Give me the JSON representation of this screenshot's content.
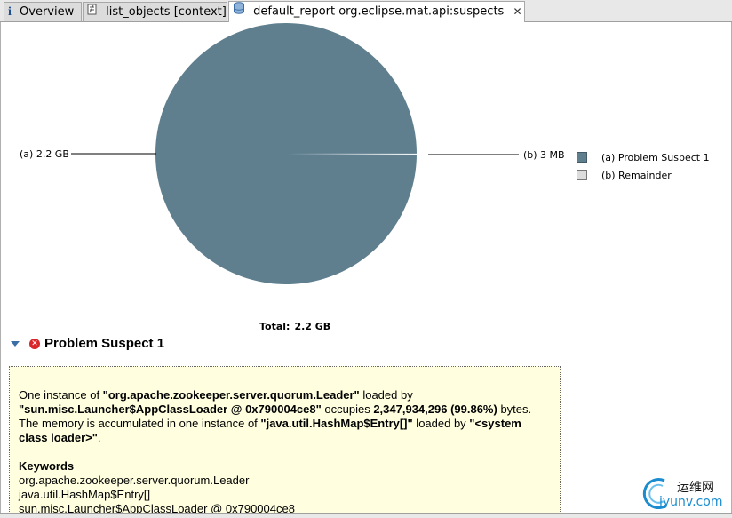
{
  "tabs": [
    {
      "label": "Overview",
      "icon": "info-icon"
    },
    {
      "label": "list_objects [context]",
      "icon": "document-icon"
    },
    {
      "label": "default_report  org.eclipse.mat.api:suspects",
      "icon": "database-icon",
      "active": true
    }
  ],
  "chart_data": {
    "type": "pie",
    "slices": [
      {
        "id": "a",
        "label": "(a)  2.2 GB",
        "value_mb": 2239.2,
        "name": "Problem Suspect 1",
        "color": "#5f7f8f"
      },
      {
        "id": "b",
        "label": "(b)  3 MB",
        "value_mb": 3,
        "name": "Remainder",
        "color": "#dcdcdc"
      }
    ],
    "legend": [
      "(a)  Problem Suspect 1",
      "(b)  Remainder"
    ],
    "legend_position": "right",
    "total_label": "Total:",
    "total_value": "2.2 GB"
  },
  "section": {
    "title": "Problem Suspect 1",
    "twisty_icon": "expand-down-triangle-icon",
    "status_icon": "error-icon"
  },
  "description": {
    "l1_a": "One instance of ",
    "l1_b": "\"org.apache.zookeeper.server.quorum.Leader\"",
    "l1_c": " loaded by",
    "l2_a": "\"sun.misc.Launcher$AppClassLoader @ 0x790004ce8\"",
    "l2_b": " occupies ",
    "l2_c": "2,347,934,296 (99.86%)",
    "l2_d": " bytes.",
    "l3_a": "The memory is accumulated in one instance of ",
    "l3_b": "\"java.util.HashMap$Entry[]\"",
    "l3_c": " loaded by ",
    "l3_d": "\"<system",
    "l4_a": "class loader>\"",
    "l4_b": "."
  },
  "keywords": {
    "title": "Keywords",
    "items": [
      "org.apache.zookeeper.server.quorum.Leader",
      "java.util.HashMap$Entry[]",
      "sun.misc.Launcher$AppClassLoader @ 0x790004ce8"
    ]
  },
  "watermark": {
    "cn": "运维网",
    "en": "iyunv.com"
  }
}
